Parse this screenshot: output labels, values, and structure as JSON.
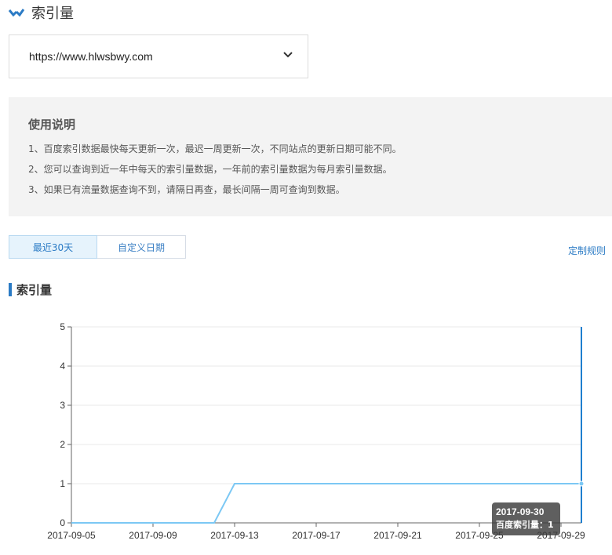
{
  "header": {
    "title": "索引量",
    "icon": "check-chevron-icon",
    "icon_color": "#2b7bc5"
  },
  "site_select": {
    "value": "https://www.hlwsbwy.com",
    "icon": "chevron-down-icon"
  },
  "instructions": {
    "title": "使用说明",
    "lines": [
      "1、百度索引数据最快每天更新一次，最迟一周更新一次，不同站点的更新日期可能不同。",
      "2、您可以查询到近一年中每天的索引量数据，一年前的索引量数据为每月索引量数据。",
      "3、如果已有流量数据查询不到，请隔日再查，最长间隔一周可查询到数据。"
    ]
  },
  "tabs": [
    {
      "label": "最近30天",
      "active": true
    },
    {
      "label": "自定义日期",
      "active": false
    }
  ],
  "custom_rules_link": "定制规则",
  "section": {
    "title": "索引量"
  },
  "tooltip": {
    "date": "2017-09-30",
    "value_text": "百度索引量：1"
  },
  "chart_data": {
    "type": "line",
    "title": "",
    "xlabel": "",
    "ylabel": "",
    "ylim": [
      0,
      5
    ],
    "yticks": [
      0,
      1,
      2,
      3,
      4,
      5
    ],
    "x_tick_labels": [
      "2017-09-05",
      "2017-09-09",
      "2017-09-13",
      "2017-09-17",
      "2017-09-21",
      "2017-09-25",
      "2017-09-29"
    ],
    "grid": true,
    "line_color": "#7cc8f4",
    "cursor_color": "#1f7fcf",
    "x": [
      "2017-09-05",
      "2017-09-06",
      "2017-09-07",
      "2017-09-08",
      "2017-09-09",
      "2017-09-10",
      "2017-09-11",
      "2017-09-12",
      "2017-09-13",
      "2017-09-14",
      "2017-09-15",
      "2017-09-16",
      "2017-09-17",
      "2017-09-18",
      "2017-09-19",
      "2017-09-20",
      "2017-09-21",
      "2017-09-22",
      "2017-09-23",
      "2017-09-24",
      "2017-09-25",
      "2017-09-26",
      "2017-09-27",
      "2017-09-28",
      "2017-09-29",
      "2017-09-30"
    ],
    "series": [
      {
        "values": [
          0,
          0,
          0,
          0,
          0,
          0,
          0,
          0,
          1,
          1,
          1,
          1,
          1,
          1,
          1,
          1,
          1,
          1,
          1,
          1,
          1,
          1,
          1,
          1,
          1,
          1
        ]
      }
    ],
    "highlight": {
      "x": "2017-09-30",
      "value": 1
    }
  }
}
